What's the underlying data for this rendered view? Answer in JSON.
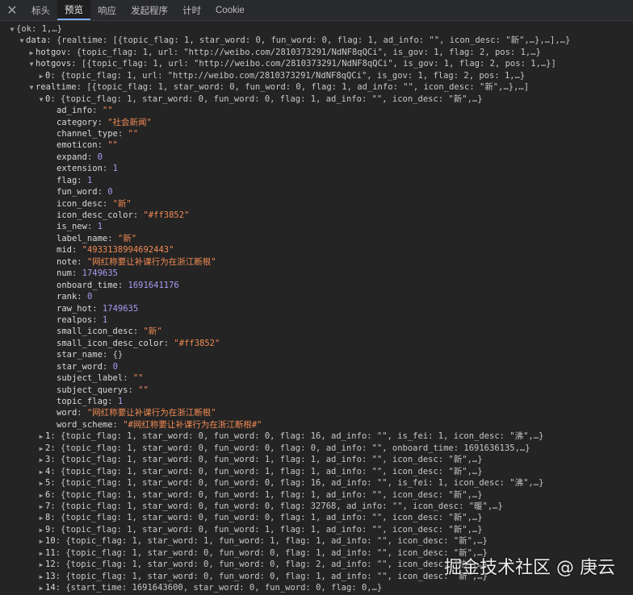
{
  "tabs": [
    {
      "label": "标头",
      "active": false
    },
    {
      "label": "预览",
      "active": true
    },
    {
      "label": "响应",
      "active": false
    },
    {
      "label": "发起程序",
      "active": false
    },
    {
      "label": "计时",
      "active": false
    },
    {
      "label": "Cookie",
      "active": false
    }
  ],
  "tree": [
    {
      "indent": 0,
      "tri": "down",
      "key": "",
      "text": "{ok: 1,…}"
    },
    {
      "indent": 1,
      "tri": "down",
      "key": "data",
      "text": "{realtime: [{topic_flag: 1, star_word: 0, fun_word: 0, flag: 1, ad_info: \"\", icon_desc: \"新\",…},…],…}"
    },
    {
      "indent": 2,
      "tri": "right",
      "key": "hotgov",
      "text": "{topic_flag: 1, url: \"http://weibo.com/2810373291/NdNF8qQCi\", is_gov: 1, flag: 2, pos: 1,…}"
    },
    {
      "indent": 2,
      "tri": "down",
      "key": "hotgovs",
      "text": "[{topic_flag: 1, url: \"http://weibo.com/2810373291/NdNF8qQCi\", is_gov: 1, flag: 2, pos: 1,…}]"
    },
    {
      "indent": 3,
      "tri": "right",
      "key": "0",
      "text": "{topic_flag: 1, url: \"http://weibo.com/2810373291/NdNF8qQCi\", is_gov: 1, flag: 2, pos: 1,…}"
    },
    {
      "indent": 2,
      "tri": "down",
      "key": "realtime",
      "text": "[{topic_flag: 1, star_word: 0, fun_word: 0, flag: 1, ad_info: \"\", icon_desc: \"新\",…},…]"
    },
    {
      "indent": 3,
      "tri": "down",
      "key": "0",
      "text": "{topic_flag: 1, star_word: 0, fun_word: 0, flag: 1, ad_info: \"\", icon_desc: \"新\",…}"
    },
    {
      "indent": 4,
      "tri": "none",
      "key": "ad_info",
      "text": "\"\"",
      "type": "s"
    },
    {
      "indent": 4,
      "tri": "none",
      "key": "category",
      "text": "\"社会新闻\"",
      "type": "s"
    },
    {
      "indent": 4,
      "tri": "none",
      "key": "channel_type",
      "text": "\"\"",
      "type": "s"
    },
    {
      "indent": 4,
      "tri": "none",
      "key": "emoticon",
      "text": "\"\"",
      "type": "s"
    },
    {
      "indent": 4,
      "tri": "none",
      "key": "expand",
      "text": "0",
      "type": "n"
    },
    {
      "indent": 4,
      "tri": "none",
      "key": "extension",
      "text": "1",
      "type": "n"
    },
    {
      "indent": 4,
      "tri": "none",
      "key": "flag",
      "text": "1",
      "type": "n"
    },
    {
      "indent": 4,
      "tri": "none",
      "key": "fun_word",
      "text": "0",
      "type": "n"
    },
    {
      "indent": 4,
      "tri": "none",
      "key": "icon_desc",
      "text": "\"新\"",
      "type": "s"
    },
    {
      "indent": 4,
      "tri": "none",
      "key": "icon_desc_color",
      "text": "\"#ff3852\"",
      "type": "s"
    },
    {
      "indent": 4,
      "tri": "none",
      "key": "is_new",
      "text": "1",
      "type": "n"
    },
    {
      "indent": 4,
      "tri": "none",
      "key": "label_name",
      "text": "\"新\"",
      "type": "s"
    },
    {
      "indent": 4,
      "tri": "none",
      "key": "mid",
      "text": "\"4933138994692443\"",
      "type": "s"
    },
    {
      "indent": 4,
      "tri": "none",
      "key": "note",
      "text": "\"网红称要让补课行为在浙江断根\"",
      "type": "s"
    },
    {
      "indent": 4,
      "tri": "none",
      "key": "num",
      "text": "1749635",
      "type": "n"
    },
    {
      "indent": 4,
      "tri": "none",
      "key": "onboard_time",
      "text": "1691641176",
      "type": "n"
    },
    {
      "indent": 4,
      "tri": "none",
      "key": "rank",
      "text": "0",
      "type": "n"
    },
    {
      "indent": 4,
      "tri": "none",
      "key": "raw_hot",
      "text": "1749635",
      "type": "n"
    },
    {
      "indent": 4,
      "tri": "none",
      "key": "realpos",
      "text": "1",
      "type": "n"
    },
    {
      "indent": 4,
      "tri": "none",
      "key": "small_icon_desc",
      "text": "\"新\"",
      "type": "s"
    },
    {
      "indent": 4,
      "tri": "none",
      "key": "small_icon_desc_color",
      "text": "\"#ff3852\"",
      "type": "s"
    },
    {
      "indent": 4,
      "tri": "none",
      "key": "star_name",
      "text": "{}",
      "type": "d"
    },
    {
      "indent": 4,
      "tri": "none",
      "key": "star_word",
      "text": "0",
      "type": "n"
    },
    {
      "indent": 4,
      "tri": "none",
      "key": "subject_label",
      "text": "\"\"",
      "type": "s"
    },
    {
      "indent": 4,
      "tri": "none",
      "key": "subject_querys",
      "text": "\"\"",
      "type": "s"
    },
    {
      "indent": 4,
      "tri": "none",
      "key": "topic_flag",
      "text": "1",
      "type": "n"
    },
    {
      "indent": 4,
      "tri": "none",
      "key": "word",
      "text": "\"网红称要让补课行为在浙江断根\"",
      "type": "s"
    },
    {
      "indent": 4,
      "tri": "none",
      "key": "word_scheme",
      "text": "\"#网红称要让补课行为在浙江断根#\"",
      "type": "s"
    },
    {
      "indent": 3,
      "tri": "right",
      "key": "1",
      "text": "{topic_flag: 1, star_word: 0, fun_word: 0, flag: 16, ad_info: \"\", is_fei: 1, icon_desc: \"沸\",…}"
    },
    {
      "indent": 3,
      "tri": "right",
      "key": "2",
      "text": "{topic_flag: 1, star_word: 0, fun_word: 0, flag: 0, ad_info: \"\", onboard_time: 1691636135,…}"
    },
    {
      "indent": 3,
      "tri": "right",
      "key": "3",
      "text": "{topic_flag: 1, star_word: 0, fun_word: 1, flag: 1, ad_info: \"\", icon_desc: \"新\",…}"
    },
    {
      "indent": 3,
      "tri": "right",
      "key": "4",
      "text": "{topic_flag: 1, star_word: 0, fun_word: 1, flag: 1, ad_info: \"\", icon_desc: \"新\",…}"
    },
    {
      "indent": 3,
      "tri": "right",
      "key": "5",
      "text": "{topic_flag: 1, star_word: 0, fun_word: 0, flag: 16, ad_info: \"\", is_fei: 1, icon_desc: \"沸\",…}"
    },
    {
      "indent": 3,
      "tri": "right",
      "key": "6",
      "text": "{topic_flag: 1, star_word: 0, fun_word: 1, flag: 1, ad_info: \"\", icon_desc: \"新\",…}"
    },
    {
      "indent": 3,
      "tri": "right",
      "key": "7",
      "text": "{topic_flag: 1, star_word: 0, fun_word: 0, flag: 32768, ad_info: \"\", icon_desc: \"暖\",…}"
    },
    {
      "indent": 3,
      "tri": "right",
      "key": "8",
      "text": "{topic_flag: 1, star_word: 0, fun_word: 0, flag: 1, ad_info: \"\", icon_desc: \"新\",…}"
    },
    {
      "indent": 3,
      "tri": "right",
      "key": "9",
      "text": "{topic_flag: 1, star_word: 0, fun_word: 1, flag: 1, ad_info: \"\", icon_desc: \"新\",…}"
    },
    {
      "indent": 3,
      "tri": "right",
      "key": "10",
      "text": "{topic_flag: 1, star_word: 1, fun_word: 1, flag: 1, ad_info: \"\", icon_desc: \"新\",…}"
    },
    {
      "indent": 3,
      "tri": "right",
      "key": "11",
      "text": "{topic_flag: 1, star_word: 0, fun_word: 0, flag: 1, ad_info: \"\", icon_desc: \"新\",…}"
    },
    {
      "indent": 3,
      "tri": "right",
      "key": "12",
      "text": "{topic_flag: 1, star_word: 0, fun_word: 0, flag: 2, ad_info: \"\", icon_desc: \"热\",…}"
    },
    {
      "indent": 3,
      "tri": "right",
      "key": "13",
      "text": "{topic_flag: 1, star_word: 0, fun_word: 0, flag: 1, ad_info: \"\", icon_desc: \"新\",…}"
    },
    {
      "indent": 3,
      "tri": "right",
      "key": "14",
      "text": "{start_time: 1691643600, star_word: 0, fun_word: 0, flag: 0,…}"
    }
  ],
  "watermark": "掘金技术社区 @ 庚云"
}
